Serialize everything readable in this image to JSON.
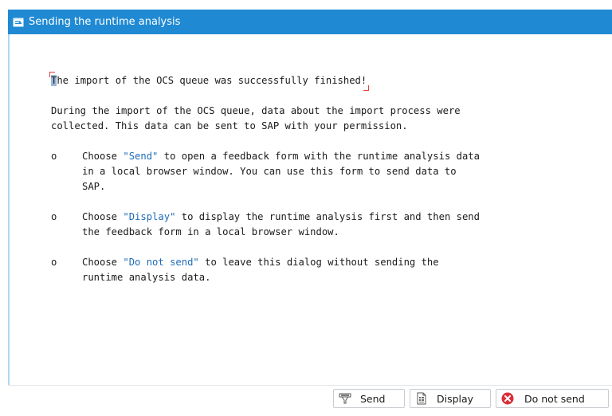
{
  "window": {
    "title": "Sending the runtime analysis",
    "title_icon": "dialog-icon",
    "accent_color": "#1f8ad3"
  },
  "content": {
    "headline": "The import of the OCS queue was successfully finished!",
    "intro_line1": "During the import of the OCS queue, data about the import process were",
    "intro_line2": "collected. This data can be sent to SAP with your permission.",
    "bullets": [
      {
        "mark": "o",
        "prefix": "Choose ",
        "keyword": "\"Send\"",
        "line1_rest": " to open a feedback form with the runtime analysis data",
        "line2": "in a local browser window. You can use this form to send data to",
        "line3": "SAP."
      },
      {
        "mark": "o",
        "prefix": "Choose ",
        "keyword": "\"Display\"",
        "line1_rest": " to display the runtime analysis first and then send",
        "line2": "the feedback form in a local browser window."
      },
      {
        "mark": "o",
        "prefix": "Choose ",
        "keyword": "\"Do not send\"",
        "line1_rest": " to leave this dialog without sending the",
        "line2": "runtime analysis data."
      }
    ],
    "keyword_color": "#1e6bb8"
  },
  "footer": {
    "send_label": "Send",
    "send_icon": "send-icon",
    "display_label": "Display",
    "display_icon": "display-icon",
    "cancel_label": "Do not send",
    "cancel_icon": "cancel-icon",
    "cancel_icon_color": "#d9303a"
  }
}
